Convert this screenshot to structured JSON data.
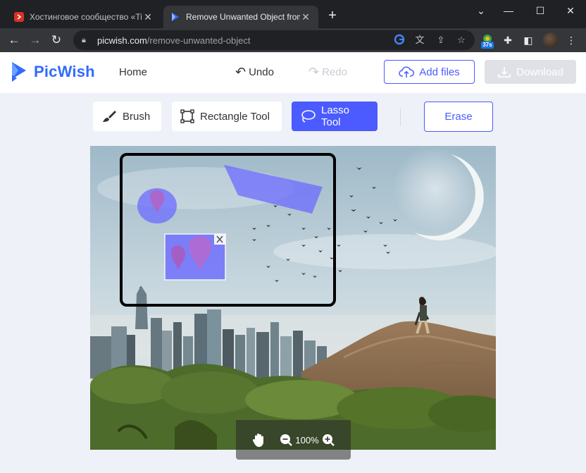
{
  "browser": {
    "tabs": [
      {
        "title": "Хостинговое сообщество «Time",
        "active": false
      },
      {
        "title": "Remove Unwanted Object from P",
        "active": true
      }
    ],
    "new_tab_icon": "plus-icon",
    "url_host": "picwish.com",
    "url_path": "/remove-unwanted-object",
    "extension_badge": "37s"
  },
  "app": {
    "logo": "PicWish",
    "nav_home": "Home",
    "undo": "Undo",
    "redo": "Redo",
    "add_files": "Add files",
    "download": "Download",
    "accent_color": "#4b5bff"
  },
  "tools": {
    "brush": "Brush",
    "rectangle": "Rectangle Tool",
    "lasso": "Lasso Tool",
    "selected": "Lasso Tool",
    "erase": "Erase"
  },
  "zoom": {
    "level": "100%"
  }
}
